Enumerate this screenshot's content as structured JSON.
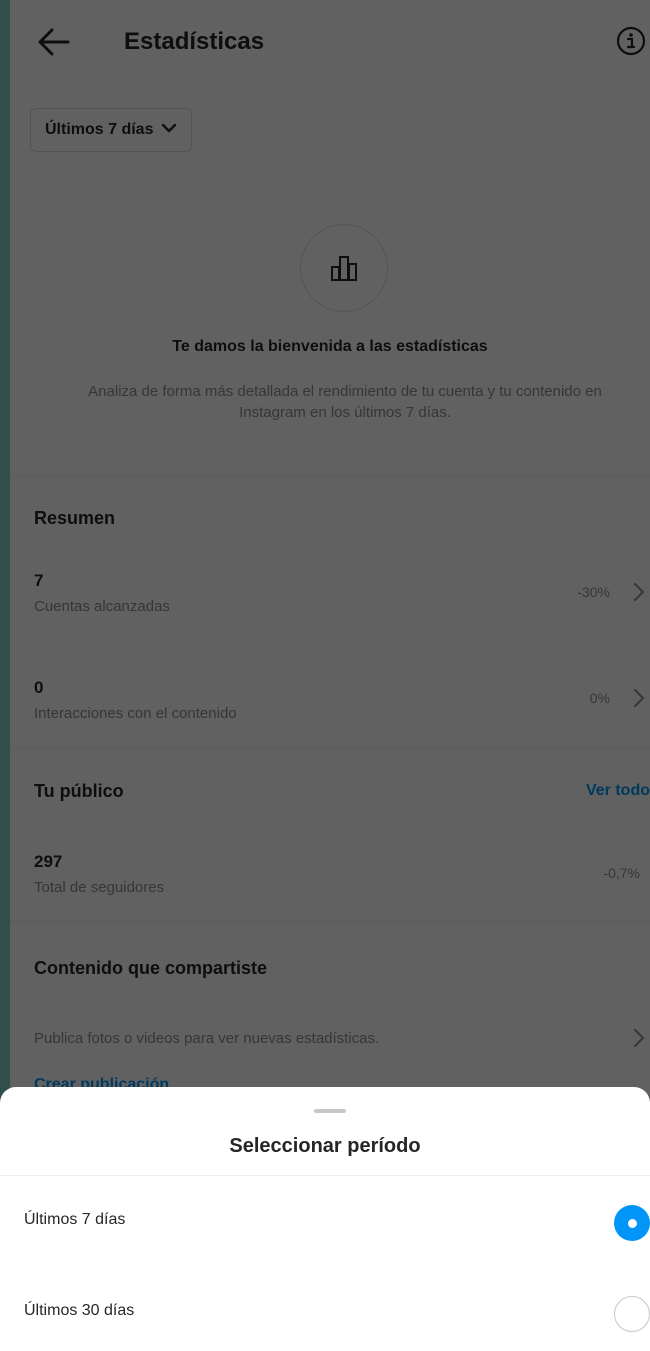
{
  "header": {
    "title": "Estadísticas",
    "back_icon": "arrow-left-icon",
    "info_icon": "info-icon"
  },
  "period_selector": {
    "label": "Últimos 7 días",
    "icon": "chevron-down-icon"
  },
  "welcome": {
    "icon": "bar-chart-icon",
    "title": "Te damos la bienvenida a las estadísticas",
    "description": "Analiza de forma más detallada el rendimiento de tu cuenta y tu contenido en Instagram en los últimos 7 días."
  },
  "summary": {
    "title": "Resumen",
    "metrics": [
      {
        "value": "7",
        "label": "Cuentas alcanzadas",
        "delta": "-30%"
      },
      {
        "value": "0",
        "label": "Interacciones con el contenido",
        "delta": "0%"
      }
    ]
  },
  "audience": {
    "title": "Tu público",
    "see_all": "Ver todo",
    "value": "297",
    "label": "Total de seguidores",
    "delta": "-0,7%"
  },
  "content": {
    "title": "Contenido que compartiste",
    "description": "Publica fotos o videos para ver nuevas estadísticas.",
    "create_link": "Crear publicación"
  },
  "sheet": {
    "title": "Seleccionar período",
    "options": [
      {
        "label": "Últimos 7 días",
        "selected": true
      },
      {
        "label": "Últimos 30 días",
        "selected": false
      }
    ]
  },
  "colors": {
    "accent": "#0095f6",
    "text": "#262626",
    "muted": "#8e8e8e",
    "overlay": "rgba(0,0,0,0.62)"
  }
}
